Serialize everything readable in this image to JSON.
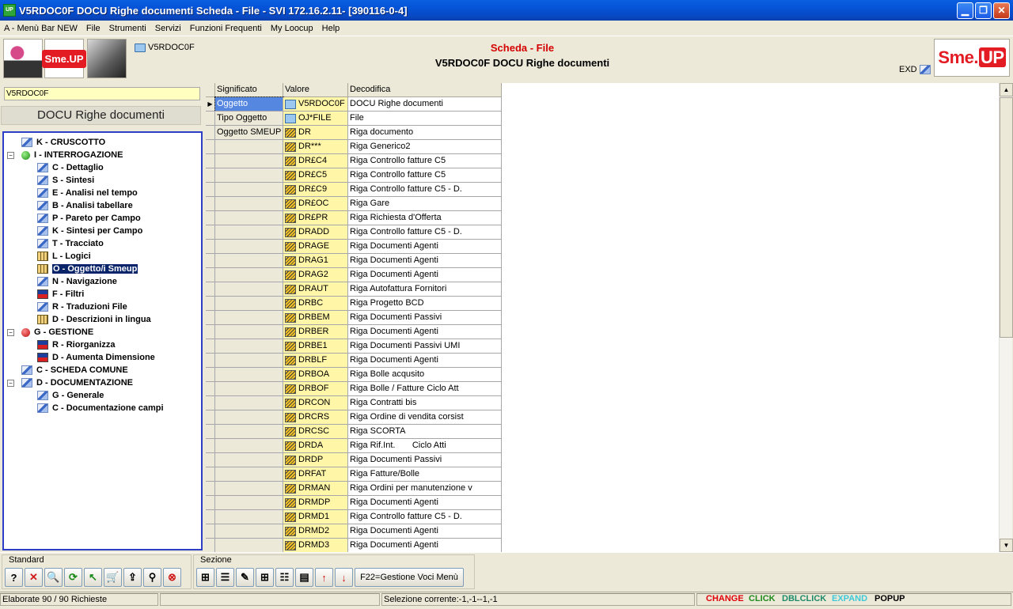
{
  "window": {
    "title": "V5RDOC0F DOCU Righe documenti Scheda - File - SVI 172.16.2.11- [390116-0-4]",
    "app_icon_text": "UP",
    "min_glyph": "▁",
    "max_glyph": "❐",
    "close_glyph": "✕"
  },
  "menu": [
    "A - Menù Bar NEW",
    "File",
    "Strumenti",
    "Servizi",
    "Funzioni Frequenti",
    "My Loocup",
    "Help"
  ],
  "header": {
    "object_code": "V5RDOC0F",
    "scheda_label": "Scheda - File",
    "description": "V5RDOC0F DOCU Righe documenti",
    "exd_label": "EXD",
    "logo_small": "Sme.UP",
    "logo_big_left": "Sme.",
    "logo_big_right": "UP"
  },
  "left": {
    "input_value": "V5RDOC0F",
    "description": "DOCU Righe documenti"
  },
  "tree": [
    {
      "label": "K - CRUSCOTTO",
      "level": 0,
      "icon": "object-icon",
      "exp": ""
    },
    {
      "label": "I - INTERROGAZIONE",
      "level": 0,
      "icon": "green-ball-icon",
      "exp": "−"
    },
    {
      "label": "C - Dettaglio",
      "level": 1,
      "icon": "object-icon",
      "exp": ""
    },
    {
      "label": "S - Sintesi",
      "level": 1,
      "icon": "object-icon",
      "exp": ""
    },
    {
      "label": "E - Analisi nel tempo",
      "level": 1,
      "icon": "object-icon",
      "exp": ""
    },
    {
      "label": "B - Analisi tabellare",
      "level": 1,
      "icon": "object-icon",
      "exp": ""
    },
    {
      "label": "P - Pareto per Campo",
      "level": 1,
      "icon": "object-icon",
      "exp": ""
    },
    {
      "label": "K - Sintesi per Campo",
      "level": 1,
      "icon": "object-icon",
      "exp": ""
    },
    {
      "label": "T - Tracciato",
      "level": 1,
      "icon": "object-icon",
      "exp": ""
    },
    {
      "label": "L - Logici",
      "level": 1,
      "icon": "table-icon",
      "exp": ""
    },
    {
      "label": "O - Oggetto/i Smeup",
      "level": 1,
      "icon": "table-icon",
      "exp": "",
      "selected": true
    },
    {
      "label": "N - Navigazione",
      "level": 1,
      "icon": "object-icon",
      "exp": ""
    },
    {
      "label": "F - Filtri",
      "level": 1,
      "icon": "filter-icon",
      "exp": ""
    },
    {
      "label": "R - Traduzioni File",
      "level": 1,
      "icon": "object-icon",
      "exp": ""
    },
    {
      "label": "D - Descrizioni in lingua",
      "level": 1,
      "icon": "table-icon",
      "exp": ""
    },
    {
      "label": "G - GESTIONE",
      "level": 0,
      "icon": "red-ball-icon",
      "exp": "−"
    },
    {
      "label": "R - Riorganizza",
      "level": 1,
      "icon": "filter-icon",
      "exp": ""
    },
    {
      "label": "D - Aumenta Dimensione",
      "level": 1,
      "icon": "filter-icon",
      "exp": ""
    },
    {
      "label": "C - SCHEDA COMUNE",
      "level": 0,
      "icon": "object-icon",
      "exp": ""
    },
    {
      "label": "D - DOCUMENTAZIONE",
      "level": 0,
      "icon": "object-icon",
      "exp": "−"
    },
    {
      "label": "G - Generale",
      "level": 1,
      "icon": "object-icon",
      "exp": ""
    },
    {
      "label": "C - Documentazione campi",
      "level": 1,
      "icon": "object-icon",
      "exp": ""
    }
  ],
  "grid": {
    "columns": [
      "Significato",
      "Valore",
      "Decodifica"
    ],
    "rows": [
      {
        "sig": "Oggetto",
        "val": "V5RDOC0F",
        "dec": "DOCU Righe documenti",
        "icon": "folder",
        "current": true
      },
      {
        "sig": "Tipo Oggetto",
        "val": "OJ*FILE",
        "dec": "File",
        "icon": "folder"
      },
      {
        "sig": "Oggetto SMEUP",
        "val": "DR",
        "dec": "Riga documento",
        "icon": "doc"
      },
      {
        "sig": "",
        "val": "DR***",
        "dec": "Riga Generico2",
        "icon": "doc"
      },
      {
        "sig": "",
        "val": "DR£C4",
        "dec": "Riga Controllo fatture C5",
        "icon": "doc"
      },
      {
        "sig": "",
        "val": "DR£C5",
        "dec": "Riga Controllo fatture C5",
        "icon": "doc"
      },
      {
        "sig": "",
        "val": "DR£C9",
        "dec": "Riga Controllo fatture C5 - D.",
        "icon": "doc"
      },
      {
        "sig": "",
        "val": "DR£OC",
        "dec": "Riga Gare",
        "icon": "doc"
      },
      {
        "sig": "",
        "val": "DR£PR",
        "dec": "Riga Richiesta d'Offerta",
        "icon": "doc"
      },
      {
        "sig": "",
        "val": "DRADD",
        "dec": "Riga Controllo fatture C5 - D.",
        "icon": "doc"
      },
      {
        "sig": "",
        "val": "DRAGE",
        "dec": "Riga Documenti Agenti",
        "icon": "doc"
      },
      {
        "sig": "",
        "val": "DRAG1",
        "dec": "Riga Documenti Agenti",
        "icon": "doc"
      },
      {
        "sig": "",
        "val": "DRAG2",
        "dec": "Riga Documenti Agenti",
        "icon": "doc"
      },
      {
        "sig": "",
        "val": "DRAUT",
        "dec": "Riga Autofattura Fornitori",
        "icon": "doc"
      },
      {
        "sig": "",
        "val": "DRBC",
        "dec": "Riga Progetto BCD",
        "icon": "doc"
      },
      {
        "sig": "",
        "val": "DRBEM",
        "dec": "Riga Documenti Passivi",
        "icon": "doc"
      },
      {
        "sig": "",
        "val": "DRBER",
        "dec": "Riga Documenti Agenti",
        "icon": "doc"
      },
      {
        "sig": "",
        "val": "DRBE1",
        "dec": "Riga Documenti Passivi UMI",
        "icon": "doc"
      },
      {
        "sig": "",
        "val": "DRBLF",
        "dec": "Riga Documenti Agenti",
        "icon": "doc"
      },
      {
        "sig": "",
        "val": "DRBOA",
        "dec": "Riga Bolle acqusito",
        "icon": "doc"
      },
      {
        "sig": "",
        "val": "DRBOF",
        "dec": "Riga Bolle / Fatture Ciclo Att",
        "icon": "doc"
      },
      {
        "sig": "",
        "val": "DRCON",
        "dec": "Riga Contratti bis",
        "icon": "doc"
      },
      {
        "sig": "",
        "val": "DRCRS",
        "dec": "Riga Ordine di vendita corsist",
        "icon": "doc"
      },
      {
        "sig": "",
        "val": "DRCSC",
        "dec": "Riga SCORTA",
        "icon": "doc"
      },
      {
        "sig": "",
        "val": "DRDA",
        "dec": "Riga Rif.Int.       Ciclo Atti",
        "icon": "doc"
      },
      {
        "sig": "",
        "val": "DRDP",
        "dec": "Riga Documenti Passivi",
        "icon": "doc"
      },
      {
        "sig": "",
        "val": "DRFAT",
        "dec": "Riga Fatture/Bolle",
        "icon": "doc"
      },
      {
        "sig": "",
        "val": "DRMAN",
        "dec": "Riga Ordini per manutenzione v",
        "icon": "doc"
      },
      {
        "sig": "",
        "val": "DRMDP",
        "dec": "Riga Documenti Agenti",
        "icon": "doc"
      },
      {
        "sig": "",
        "val": "DRMD1",
        "dec": "Riga Controllo fatture C5 - D.",
        "icon": "doc"
      },
      {
        "sig": "",
        "val": "DRMD2",
        "dec": "Riga Documenti Agenti",
        "icon": "doc"
      },
      {
        "sig": "",
        "val": "DRMD3",
        "dec": "Riga Documenti Agenti",
        "icon": "doc"
      }
    ]
  },
  "toolbar": {
    "standard_title": "Standard",
    "sezione_title": "Sezione",
    "standard_buttons": [
      {
        "name": "help-button",
        "glyph": "?"
      },
      {
        "name": "cancel-button",
        "glyph": "✕"
      },
      {
        "name": "search-button",
        "glyph": "🔍"
      },
      {
        "name": "refresh-button",
        "glyph": "⟳"
      },
      {
        "name": "back-button",
        "glyph": "↖"
      },
      {
        "name": "cart-button",
        "glyph": "🛒"
      },
      {
        "name": "export-button",
        "glyph": "⇪"
      },
      {
        "name": "find-button",
        "glyph": "⚲"
      },
      {
        "name": "stop-button",
        "glyph": "⊗"
      }
    ],
    "sezione_buttons": [
      {
        "name": "tree-layout-button",
        "glyph": "⊞"
      },
      {
        "name": "list-layout-button",
        "glyph": "☰"
      },
      {
        "name": "edit-section-button",
        "glyph": "✎"
      },
      {
        "name": "tree-add-button",
        "glyph": "⊞"
      },
      {
        "name": "tree-one-button",
        "glyph": "☷"
      },
      {
        "name": "form-button",
        "glyph": "▤"
      },
      {
        "name": "move-up-button",
        "glyph": "↑"
      },
      {
        "name": "move-down-button",
        "glyph": "↓"
      }
    ],
    "f22_label": "F22=Gestione Voci Menù"
  },
  "status": {
    "elaborate": "Elaborate 90 / 90 Richieste",
    "selection": "Selezione corrente:-1,-1--1,-1",
    "flags": [
      {
        "label": "CHANGE",
        "color": "#e0000a"
      },
      {
        "label": "CLICK",
        "color": "#1f8a1f"
      },
      {
        "label": "DBLCLICK",
        "color": "#1f8a6a"
      },
      {
        "label": "EXPAND",
        "color": "#3ec8d8"
      },
      {
        "label": "POPUP",
        "color": "#000000"
      }
    ]
  }
}
